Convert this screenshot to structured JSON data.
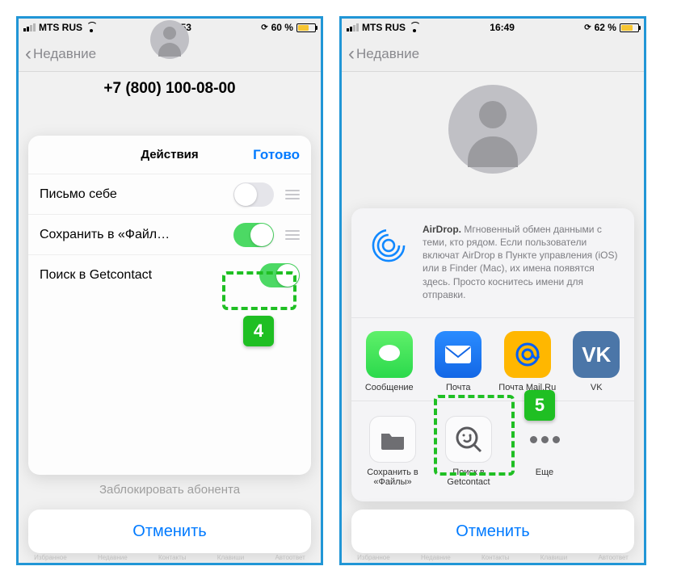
{
  "left": {
    "status": {
      "carrier": "MTS RUS",
      "time": "16:53",
      "battery": "60 %"
    },
    "nav_back": "Недавние",
    "phone_number": "+7 (800) 100-08-00",
    "sheet_title": "Действия",
    "done_label": "Готово",
    "rows": [
      {
        "label": "Письмо себе",
        "on": false
      },
      {
        "label": "Сохранить в «Файл…",
        "on": true
      },
      {
        "label": "Поиск в Getcontact",
        "on": true
      }
    ],
    "dimmed_below": "Заблокировать абонента",
    "cancel": "Отменить",
    "callout_badge": "4",
    "tabbar": [
      "Избранное",
      "Недавние",
      "Контакты",
      "Клавиши",
      "Автоответ"
    ]
  },
  "right": {
    "status": {
      "carrier": "MTS RUS",
      "time": "16:49",
      "battery": "62 %"
    },
    "nav_back": "Недавние",
    "airdrop_title": "AirDrop.",
    "airdrop_text": " Мгновенный обмен данными с теми, кто рядом. Если пользователи включат AirDrop в Пункте управления (iOS) или в Finder (Mac), их имена появятся здесь. Просто коснитесь имени для отправки.",
    "apps": [
      {
        "label": "Сообщение"
      },
      {
        "label": "Почта"
      },
      {
        "label": "Почта Mail.Ru"
      },
      {
        "label": "VK"
      }
    ],
    "actions": [
      {
        "label": "Сохранить в «Файлы»"
      },
      {
        "label": "Поиск в Getcontact"
      },
      {
        "label": "Еще"
      }
    ],
    "cancel": "Отменить",
    "callout_badge": "5",
    "tabbar": [
      "Избранное",
      "Недавние",
      "Контакты",
      "Клавиши",
      "Автоответ"
    ]
  }
}
